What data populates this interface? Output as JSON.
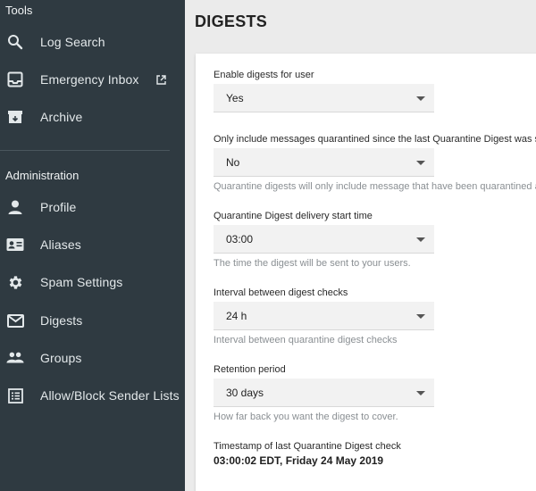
{
  "sidebar": {
    "tools_heading": "Tools",
    "tools_items": [
      {
        "label": "Log Search",
        "icon": "search-icon"
      },
      {
        "label": "Emergency Inbox",
        "icon": "inbox-icon",
        "external": "external-link-icon"
      },
      {
        "label": "Archive",
        "icon": "archive-icon"
      }
    ],
    "admin_heading": "Administration",
    "admin_items": [
      {
        "label": "Profile",
        "icon": "person-icon"
      },
      {
        "label": "Aliases",
        "icon": "id-card-icon"
      },
      {
        "label": "Spam Settings",
        "icon": "gear-icon"
      },
      {
        "label": "Digests",
        "icon": "mail-icon"
      },
      {
        "label": "Groups",
        "icon": "group-icon"
      },
      {
        "label": "Allow/Block Sender Lists",
        "icon": "list-icon"
      }
    ]
  },
  "main": {
    "title": "DIGESTS",
    "fields": [
      {
        "label": "Enable digests for user",
        "value": "Yes",
        "helper": ""
      },
      {
        "label": "Only include messages quarantined since the last Quarantine Digest was sent",
        "value": "No",
        "helper": "Quarantine digests will only include message that have been quarantined after the last digest was sent"
      },
      {
        "label": "Quarantine Digest delivery start time",
        "value": "03:00",
        "helper": "The time the digest will be sent to your users."
      },
      {
        "label": "Interval between digest checks",
        "value": "24 h",
        "helper": "Interval between quarantine digest checks"
      },
      {
        "label": "Retention period",
        "value": "30 days",
        "helper": "How far back you want the digest to cover."
      }
    ],
    "timestamp_label": "Timestamp of last Quarantine Digest check",
    "timestamp_value": "03:00:02 EDT, Friday 24 May 2019"
  }
}
